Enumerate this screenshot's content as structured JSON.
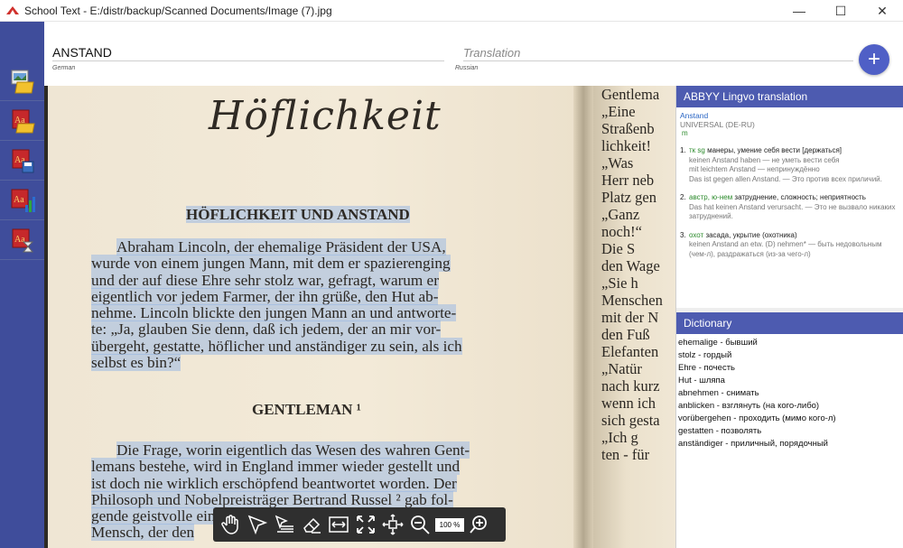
{
  "window": {
    "title": "School Text - E:/distr/backup/Scanned Documents/Image (7).jpg",
    "minimize": "—",
    "maximize": "☐",
    "close": "✕"
  },
  "header": {
    "word": "ANSTAND",
    "source_lang": "German",
    "translation_placeholder": "Translation",
    "target_lang": "Russian",
    "add_label": "+"
  },
  "sidebar": {
    "items": [
      {
        "icon": "open-image-icon"
      },
      {
        "icon": "open-dictionary-icon"
      },
      {
        "icon": "save-dictionary-icon"
      },
      {
        "icon": "statistics-icon"
      },
      {
        "icon": "dictionary-timer-icon"
      }
    ]
  },
  "document": {
    "title": "Höflichkeit",
    "heading1": "HÖFLICHKEIT UND ANSTAND",
    "para1": [
      "Abraham Lincoln, der ehemalige  Präsident der USA,",
      "wurde von einem jungen Mann, mit dem er spazierenging",
      "und der auf diese Ehre sehr stolz war, gefragt, warum er",
      "eigentlich vor jedem Farmer, der ihn grüße, den Hut ab-",
      "nehme. Lincoln blickte den jungen Mann an und antworte-",
      "te: „Ja, glauben Sie denn, daß ich jedem, der an mir vor-",
      "übergeht, gestatte, höflicher und anständiger zu sein, als ich",
      "selbst es bin?“"
    ],
    "heading2": "GENTLEMAN ¹",
    "para2": [
      "Die Frage, worin eigentlich das Wesen des wahren Gent-",
      "lemans bestehe, wird in England immer wieder gestellt und",
      "ist doch nie wirklich erschöpfend beantwortet worden. Der",
      "Philosoph und Nobelpreisträger Bertrand Russel ² gab fol-",
      "gende   geistvolle                                                   ein",
      "Mensch, der den                                                  "
    ],
    "right_page": [
      "Gentlema",
      "",
      "„Eine",
      "Straßenb",
      "lichkeit!",
      "„Was",
      "Herr neb",
      "Platz gen",
      "„Ganz",
      "noch!“",
      "",
      "",
      "  Die S",
      "den Wage",
      "„Sie h",
      "Menschen",
      "mit der N",
      "den Fuß",
      "Elefanten",
      "„Natür",
      "nach kurz",
      "wenn ich",
      "sich gesta",
      "„Ich g",
      "ten - für"
    ]
  },
  "toolbar": {
    "zoom": "100 %",
    "tools": [
      "hand-tool-icon",
      "select-arrow-icon",
      "text-select-icon",
      "eraser-icon",
      "fit-width-icon",
      "fit-page-icon",
      "fit-all-icon",
      "zoom-out-icon",
      "zoom-in-icon"
    ]
  },
  "lingvo": {
    "header": "ABBYY Lingvo translation",
    "word": "Anstand",
    "dictionary": "UNIVERSAL (DE-RU)",
    "pos": "m",
    "senses": [
      {
        "num": "1.",
        "tag": "тк sg",
        "meaning": " манеры, умение себя вести [держаться]",
        "examples": [
          "keinen Anstand haben — не уметь вести себя",
          "mit leichtem Anstand — непринуждённо",
          "Das ist gegen allen Anstand. — Это против всех приличий."
        ]
      },
      {
        "num": "2.",
        "tag": "австр, ю-нем",
        "meaning": " затруднение, сложность; неприятность",
        "examples": [
          "Das hat keinen Anstand verursacht. — Это не вызвало никаких затруднений."
        ]
      },
      {
        "num": "3.",
        "tag": "охот",
        "meaning": " засада, укрытие (охотника)",
        "examples": [
          "keinen Anstand an etw. (D) nehmen* — быть недовольным (чем-л), раздражаться (из-за чего-л)"
        ]
      }
    ]
  },
  "dictionary": {
    "header": "Dictionary",
    "entries": [
      "ehemalige - бывший",
      "stolz - гордый",
      "Ehre - почесть",
      "Hut - шляпа",
      "abnehmen - снимать",
      "anblicken - взглянуть (на кого-либо)",
      "vorübergehen - проходить (мимо кого-л)",
      "gestatten - позволять",
      "anständiger - приличный, порядочный"
    ]
  },
  "colors": {
    "sidebar": "#3f4d9b",
    "panel_header": "#4d5bb0",
    "accent": "#4f5fc6",
    "highlight": "#8ab0e6"
  }
}
